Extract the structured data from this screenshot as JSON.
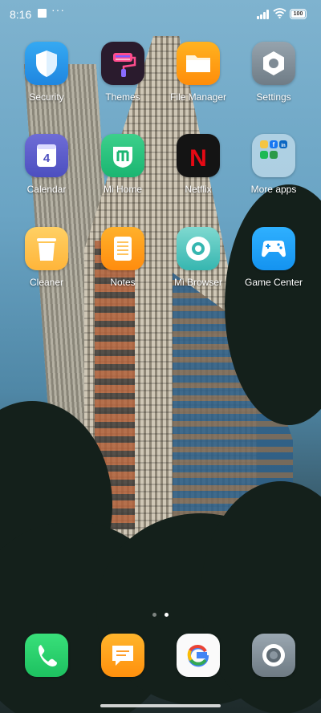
{
  "status_bar": {
    "time": "8:16",
    "more": "···",
    "battery": "100"
  },
  "apps": [
    {
      "label": "Security",
      "icon": "shield-icon"
    },
    {
      "label": "Themes",
      "icon": "paint-roller-icon"
    },
    {
      "label": "File Manager",
      "icon": "folder-icon"
    },
    {
      "label": "Settings",
      "icon": "gear-icon"
    },
    {
      "label": "Calendar",
      "icon": "calendar-icon",
      "day": "4"
    },
    {
      "label": "Mi Home",
      "icon": "mi-home-icon"
    },
    {
      "label": "Netflix",
      "icon": "netflix-icon",
      "glyph": "N"
    },
    {
      "label": "More apps",
      "icon": "app-folder-icon"
    },
    {
      "label": "Cleaner",
      "icon": "trash-can-icon"
    },
    {
      "label": "Notes",
      "icon": "notepad-icon"
    },
    {
      "label": "Mi Browser",
      "icon": "browser-ring-icon"
    },
    {
      "label": "Game Center",
      "icon": "gamepad-icon"
    }
  ],
  "folder_minis": [
    "f",
    "in"
  ],
  "dock": [
    {
      "icon": "phone-icon"
    },
    {
      "icon": "message-icon"
    },
    {
      "icon": "google-icon",
      "glyph": "G"
    },
    {
      "icon": "camera-icon"
    }
  ],
  "pages": {
    "count": 2,
    "active": 2
  },
  "colors": {
    "label": "#ffffff",
    "status": "#ffffff"
  }
}
